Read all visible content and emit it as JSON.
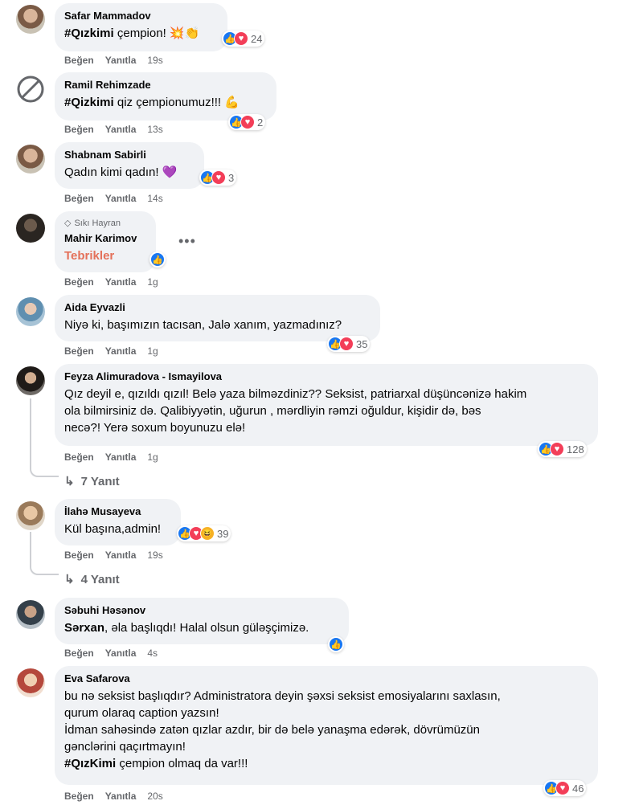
{
  "actions": {
    "like": "Beğen",
    "reply": "Yanıtla"
  },
  "comments": [
    {
      "author": "Safar Mammadov",
      "hashtag": "#Qızkimi",
      "text": " çempion! 💥👏",
      "time": "19s",
      "reactions": "24"
    },
    {
      "author": "Ramil Rehimzade",
      "hashtag": "#Qizkimi",
      "text": " qiz çempionumuz!!! 💪",
      "time": "13s",
      "reactions": "2"
    },
    {
      "author": "Shabnam Sabirli",
      "text": "Qadın kimi qadın! 💜",
      "time": "14s",
      "reactions": "3"
    },
    {
      "author": "Mahir Karimov",
      "badge": "Sıkı Hayran",
      "text": "Tebrikler",
      "time": "1g"
    },
    {
      "author": "Aida Eyvazli",
      "text": "Niyə ki, başımızın tacısan, Jalə xanım, yazmadınız?",
      "time": "1g",
      "reactions": "35"
    },
    {
      "author": "Feyza Alimuradova - Ismayilova",
      "lines": [
        "Qız deyil e, qızıldı qızıl! Belə yaza bilməzdiniz?? Seksist, patriarxal düşüncənizə hakim",
        "ola bilmirsiniz də. Qalibiyyətin, uğurun , mərdliyin rəmzi oğuldur, kişidir də, bəs",
        "necə?! Yerə soxum boyunuzu elə!"
      ],
      "time": "1g",
      "reactions": "128",
      "replies": "7 Yanıt"
    },
    {
      "author": "İlahə Musayeva",
      "text": "Kül başına,admin!",
      "time": "19s",
      "reactions": "39",
      "replies": "4 Yanıt"
    },
    {
      "author": "Səbuhi Həsənov",
      "mention": "Sərxan",
      "text": ", əla başlıqdı! Halal olsun güləşçimizə.",
      "time": "4s"
    },
    {
      "author": "Eva Safarova",
      "lines": [
        "bu nə seksist başlıqdır? Administratora deyin şəxsi seksist emosiyalarını saxlasın,",
        "qurum olaraq caption yazsın!",
        "İdman sahəsində zatən qızlar azdır, bir də belə yanaşma edərək, dövrümüzün",
        "gənclərini qaçırtmayın!"
      ],
      "hashtag": "#QızKimi",
      "last": " çempion olmaq da var!!!",
      "time": "20s",
      "reactions": "46"
    }
  ]
}
